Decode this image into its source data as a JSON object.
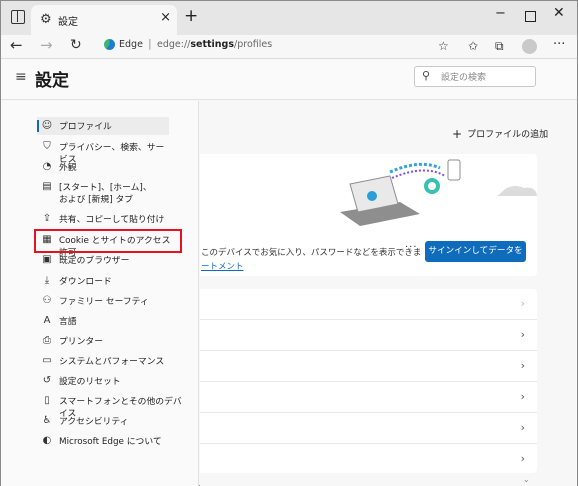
{
  "browser": {
    "tab": {
      "title": "設定",
      "icon": "gear-icon"
    },
    "new_tab": "+",
    "window_controls": {
      "minimize": "−",
      "close": "✕"
    }
  },
  "address_bar": {
    "site_label": "Edge",
    "separator": "|",
    "url_prefix": "edge://",
    "url_bold": "settings",
    "url_suffix": "/profiles"
  },
  "settings": {
    "title": "設定",
    "search_placeholder": "設定の検索",
    "sidebar": [
      {
        "icon": "profile-icon",
        "glyph": "☺",
        "label": "プロファイル"
      },
      {
        "icon": "lock-icon",
        "glyph": "⛉",
        "label": "プライバシー、検索、サービス"
      },
      {
        "icon": "appearance-icon",
        "glyph": "◔",
        "label": "外観"
      },
      {
        "icon": "start-home-icon",
        "glyph": "▤",
        "label": "[スタート]、[ホーム]、および [新規] タブ"
      },
      {
        "icon": "share-icon",
        "glyph": "⇪",
        "label": "共有、コピーして貼り付け"
      },
      {
        "icon": "cookie-site-icon",
        "glyph": "▦",
        "label": "Cookie とサイトのアクセス許可"
      },
      {
        "icon": "default-browser-icon",
        "glyph": "▣",
        "label": "既定のブラウザー"
      },
      {
        "icon": "download-icon",
        "glyph": "⤓",
        "label": "ダウンロード"
      },
      {
        "icon": "family-icon",
        "glyph": "⚇",
        "label": "ファミリー セーフティ"
      },
      {
        "icon": "language-icon",
        "glyph": "A",
        "label": "言語"
      },
      {
        "icon": "printer-icon",
        "glyph": "⎙",
        "label": "プリンター"
      },
      {
        "icon": "system-icon",
        "glyph": "▭",
        "label": "システムとパフォーマンス"
      },
      {
        "icon": "reset-icon",
        "glyph": "↺",
        "label": "設定のリセット"
      },
      {
        "icon": "phone-icon",
        "glyph": "▯",
        "label": "スマートフォンとその他のデバイス"
      },
      {
        "icon": "accessibility-icon",
        "glyph": "♿",
        "label": "アクセシビリティ"
      },
      {
        "icon": "edge-icon",
        "glyph": "◐",
        "label": "Microsoft Edge について"
      }
    ],
    "active_item": "プロファイル",
    "highlighted_item": "Cookie とサイトのアクセス許可"
  },
  "main": {
    "add_profile": "プロファイルの追加",
    "sync_card": {
      "text": "このデバイスでお気に入り、パスワードなどを表示できま",
      "link": "ートメント",
      "more": "···",
      "signin_button": "サインインしてデータを同期"
    },
    "list_rows": 6
  },
  "colors": {
    "accent": "#0f6cbd",
    "highlight": "#e81123"
  }
}
